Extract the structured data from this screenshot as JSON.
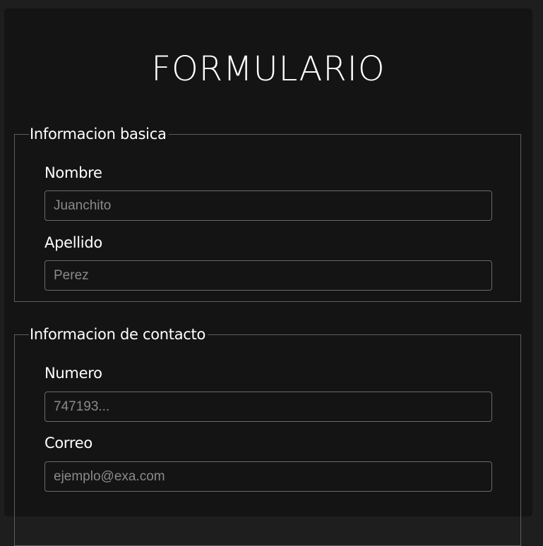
{
  "form": {
    "title": "FORMULARIO",
    "sections": [
      {
        "legend": "Informacion basica",
        "fields": [
          {
            "label": "Nombre",
            "value": "",
            "placeholder": "Juanchito"
          },
          {
            "label": "Apellido",
            "value": "",
            "placeholder": "Perez"
          }
        ]
      },
      {
        "legend": "Informacion de contacto",
        "fields": [
          {
            "label": "Numero",
            "value": "",
            "placeholder": "747193..."
          },
          {
            "label": "Correo",
            "value": "",
            "placeholder": "ejemplo@exa.com"
          }
        ]
      }
    ]
  },
  "colors": {
    "page_background": "#1e1e1e",
    "card_background": "#141414",
    "text": "#ffffff",
    "border": "#5e5e5e",
    "placeholder": "#8a8a8a"
  }
}
